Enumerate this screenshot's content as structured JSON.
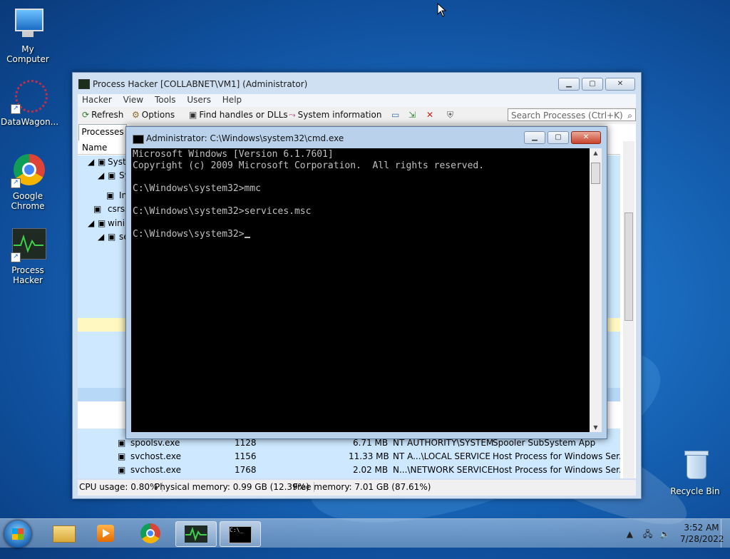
{
  "desktop": {
    "icons": [
      {
        "label": "My Computer"
      },
      {
        "label": "DataWagon..."
      },
      {
        "label": "Google Chrome"
      },
      {
        "label": "Process Hacker"
      },
      {
        "label": "Recycle Bin"
      }
    ]
  },
  "process_hacker": {
    "title": "Process Hacker [COLLABNET\\VM1] (Administrator)",
    "menu": [
      "Hacker",
      "View",
      "Tools",
      "Users",
      "Help"
    ],
    "toolbar": {
      "refresh": "Refresh",
      "options": "Options",
      "find_handles": "Find handles or DLLs",
      "system_info": "System information"
    },
    "search_placeholder": "Search Processes (Ctrl+K)",
    "tab": "Processes",
    "column_name": "Name",
    "tree_fragments": [
      "Syste",
      "Sy",
      "In",
      "csrss",
      "winin",
      "se"
    ],
    "rows": [
      {
        "name": "spoolsv.exe",
        "pid": "1128",
        "mem": "6.71 MB",
        "user": "NT AUTHORITY\\SYSTEM",
        "desc": "Spooler SubSystem App"
      },
      {
        "name": "svchost.exe",
        "pid": "1156",
        "mem": "11.33 MB",
        "user": "NT A...\\LOCAL SERVICE",
        "desc": "Host Process for Windows Ser..."
      },
      {
        "name": "svchost.exe",
        "pid": "1768",
        "mem": "2.02 MB",
        "user": "N...\\NETWORK SERVICE",
        "desc": "Host Process for Windows Ser..."
      }
    ],
    "status": {
      "cpu": "CPU usage: 0.80%",
      "physical": "Physical memory: 0.99 GB (12.39%)",
      "free": "Free memory: 7.01 GB (87.61%)"
    }
  },
  "cmd": {
    "title": "Administrator: C:\\Windows\\system32\\cmd.exe",
    "lines": [
      "Microsoft Windows [Version 6.1.7601]",
      "Copyright (c) 2009 Microsoft Corporation.  All rights reserved.",
      "",
      "C:\\Windows\\system32>mmc",
      "",
      "C:\\Windows\\system32>services.msc",
      "",
      "C:\\Windows\\system32>"
    ]
  },
  "taskbar": {
    "time": "3:52 AM",
    "date": "7/28/2022"
  },
  "colors": {
    "desktop": "#1a6cc0",
    "console_bg": "#000000",
    "console_fg": "#c0c0c0",
    "selection": "#cde8ff"
  }
}
